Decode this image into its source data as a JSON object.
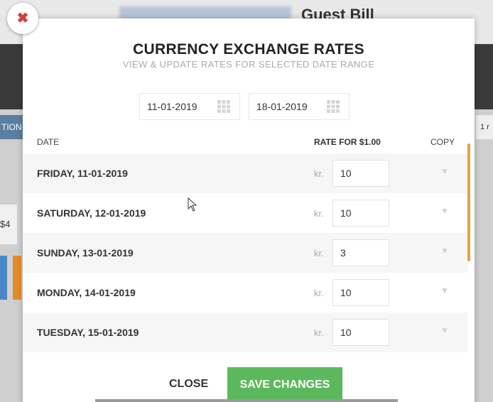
{
  "background": {
    "title": "Guest Bill",
    "left_tab_text": "TION",
    "right_tab_text": "1 r",
    "price_text": "$4"
  },
  "modal": {
    "close_icon": "close-icon",
    "title": "CURRENCY EXCHANGE RATES",
    "subtitle": "VIEW & UPDATE RATES FOR SELECTED DATE RANGE",
    "date_from": "11-01-2019",
    "date_to": "18-01-2019",
    "headers": {
      "date": "DATE",
      "rate": "RATE FOR $1.00",
      "copy": "COPY"
    },
    "rows": [
      {
        "day": "FRIDAY, 11-01-2019",
        "currency": "kr.",
        "rate": "10"
      },
      {
        "day": "SATURDAY, 12-01-2019",
        "currency": "kr.",
        "rate": "10"
      },
      {
        "day": "SUNDAY, 13-01-2019",
        "currency": "kr.",
        "rate": "3"
      },
      {
        "day": "MONDAY, 14-01-2019",
        "currency": "kr.",
        "rate": "10"
      },
      {
        "day": "TUESDAY, 15-01-2019",
        "currency": "kr.",
        "rate": "10"
      }
    ],
    "close_label": "CLOSE",
    "save_label": "SAVE CHANGES"
  },
  "colors": {
    "save": "#5cb85c",
    "scrollbar": "#e8a33d",
    "close_x": "#d43f3a"
  }
}
